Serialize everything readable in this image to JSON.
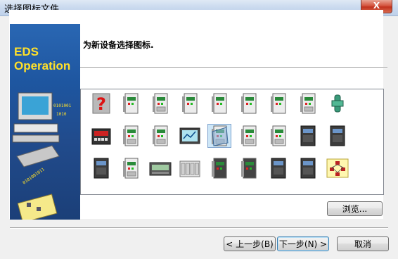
{
  "window": {
    "title": "选择图标文件",
    "close_label": "X"
  },
  "banner": {
    "line1": "EDS",
    "line2": "Operation"
  },
  "header": {
    "prompt": "为新设备选择图标."
  },
  "icons": [
    {
      "name": "unknown-device-icon"
    },
    {
      "name": "drive-module-icon-1"
    },
    {
      "name": "io-module-icon-1"
    },
    {
      "name": "controller-module-icon-1"
    },
    {
      "name": "drive-module-icon-2"
    },
    {
      "name": "drive-module-icon-3"
    },
    {
      "name": "drive-module-icon-4"
    },
    {
      "name": "terminal-module-icon"
    },
    {
      "name": "connector-icon"
    },
    {
      "name": "display-panel-icon"
    },
    {
      "name": "io-module-icon-2"
    },
    {
      "name": "network-adapter-icon"
    },
    {
      "name": "hmi-screen-icon"
    },
    {
      "name": "mounted-module-icon",
      "selected": true
    },
    {
      "name": "io-module-icon-3"
    },
    {
      "name": "network-node-icon"
    },
    {
      "name": "inverter-icon-1"
    },
    {
      "name": "inverter-icon-2"
    },
    {
      "name": "inverter-icon-3"
    },
    {
      "name": "io-module-icon-4"
    },
    {
      "name": "text-display-icon"
    },
    {
      "name": "plc-rack-icon"
    },
    {
      "name": "drive-module-icon-5"
    },
    {
      "name": "plc-module-icon"
    },
    {
      "name": "inverter-icon-4"
    },
    {
      "name": "inverter-icon-5"
    },
    {
      "name": "network-diagram-icon"
    }
  ],
  "buttons": {
    "browse": "浏览...",
    "back": "< 上一步(B)",
    "next": "下一步(N) >",
    "cancel": "取消"
  },
  "colors": {
    "banner_blue": "#1e56a0",
    "banner_text": "#ffe02a",
    "selection": "#cde6f7"
  }
}
